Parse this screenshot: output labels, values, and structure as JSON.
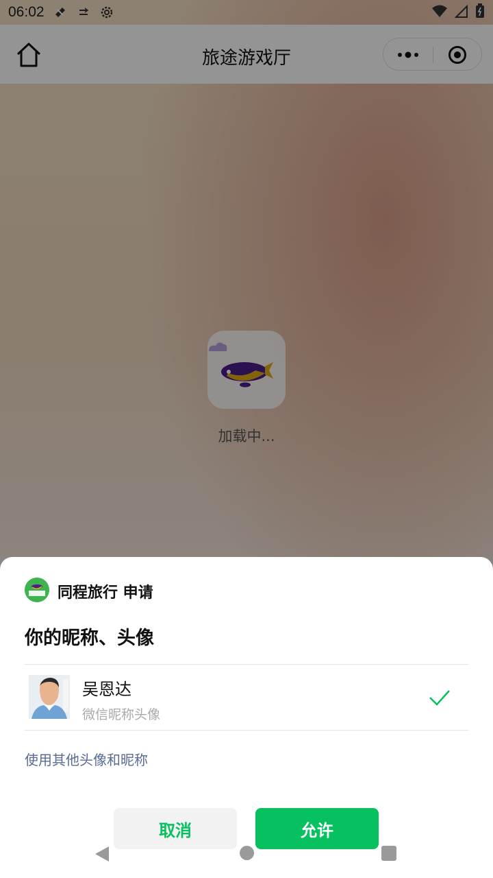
{
  "status_bar": {
    "time": "06:02",
    "icons": [
      "notification-icon",
      "data-icon",
      "settings-icon",
      "wifi-icon",
      "signal-icon",
      "battery-icon"
    ]
  },
  "nav": {
    "title": "旅途游戏厅",
    "home_icon": "home-icon",
    "more_icon": "more-icon",
    "close_icon": "target-icon"
  },
  "loading": {
    "text": "加载中..."
  },
  "auth_sheet": {
    "app_name": "同程旅行 申请",
    "request_title": "你的昵称、头像",
    "account": {
      "name": "吴恩达",
      "subtitle": "微信昵称头像",
      "selected": true
    },
    "other_link": "使用其他头像和昵称",
    "cancel_label": "取消",
    "allow_label": "允许"
  },
  "colors": {
    "accent": "#07c160",
    "link": "#576b95"
  }
}
